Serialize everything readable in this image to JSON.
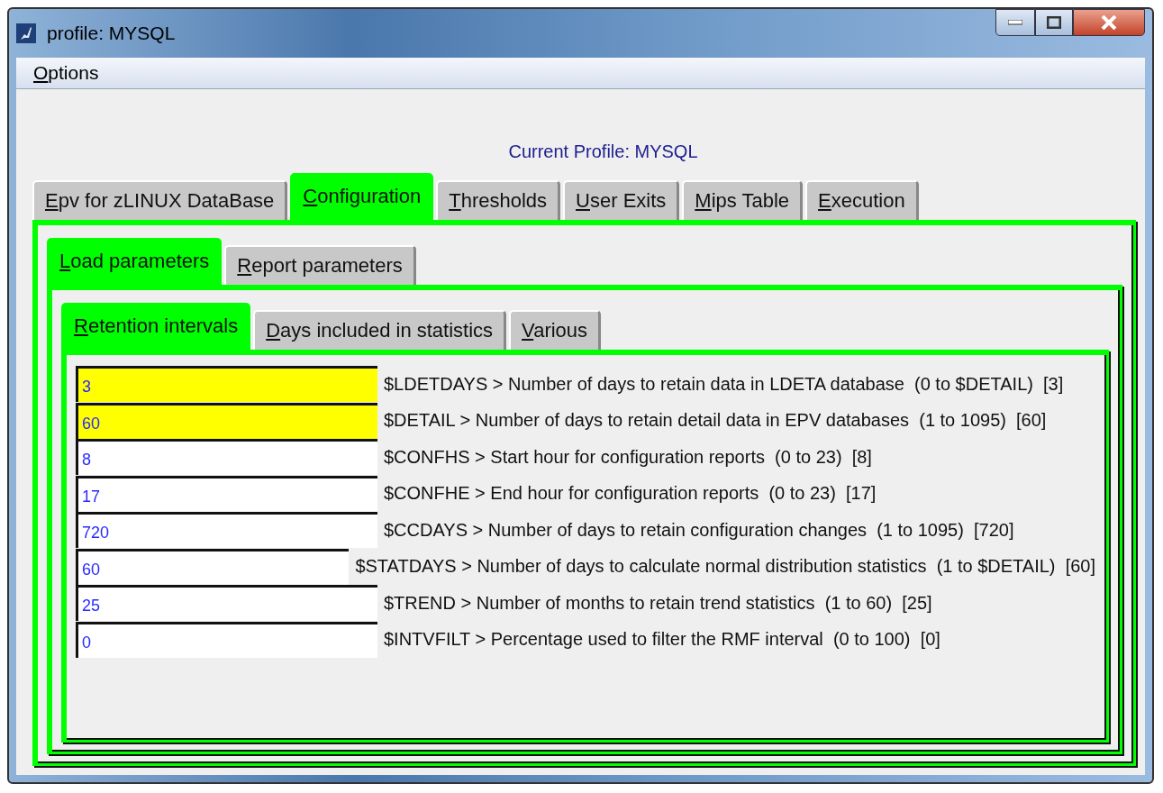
{
  "window": {
    "title": "profile: MYSQL"
  },
  "menu": [
    "Options"
  ],
  "profile_label": "Current Profile: MYSQL",
  "tabs": [
    {
      "label": "Epv for zLINUX DataBase",
      "selected": false
    },
    {
      "label": "Configuration",
      "selected": true
    },
    {
      "label": "Thresholds",
      "selected": false
    },
    {
      "label": "User Exits",
      "selected": false
    },
    {
      "label": "Mips Table",
      "selected": false
    },
    {
      "label": "Execution",
      "selected": false
    }
  ],
  "subtabs": [
    {
      "label": "Load parameters",
      "selected": true
    },
    {
      "label": "Report parameters",
      "selected": false
    }
  ],
  "sections": [
    {
      "label": "Retention intervals",
      "selected": true
    },
    {
      "label": "Days included in statistics",
      "selected": false
    },
    {
      "label": "Various",
      "selected": false
    }
  ],
  "parameters": [
    {
      "value": "3",
      "label": "$LDETDAYS > Number of days to retain data in LDETA database  (0 to $DETAIL)  [3]",
      "highlighted": true
    },
    {
      "value": "60",
      "label": "$DETAIL > Number of days to retain detail data in EPV databases  (1 to 1095)  [60]",
      "highlighted": true
    },
    {
      "value": "8",
      "label": "$CONFHS > Start hour for configuration reports  (0 to 23)  [8]",
      "highlighted": false
    },
    {
      "value": "17",
      "label": "$CONFHE > End hour for configuration reports  (0 to 23)  [17]",
      "highlighted": false
    },
    {
      "value": "720",
      "label": "$CCDAYS > Number of days to retain configuration changes  (1 to 1095)  [720]",
      "highlighted": false
    },
    {
      "value": "60",
      "label": "$STATDAYS > Number of days to calculate normal distribution statistics  (1 to $DETAIL)  [60]",
      "highlighted": false
    },
    {
      "value": "25",
      "label": "$TREND > Number of months to retain trend statistics  (1 to 60)  [25]",
      "highlighted": false
    },
    {
      "value": "0",
      "label": "$INTVFILT > Percentage used to filter the RMF interval  (0 to 100)  [0]",
      "highlighted": false
    }
  ]
}
